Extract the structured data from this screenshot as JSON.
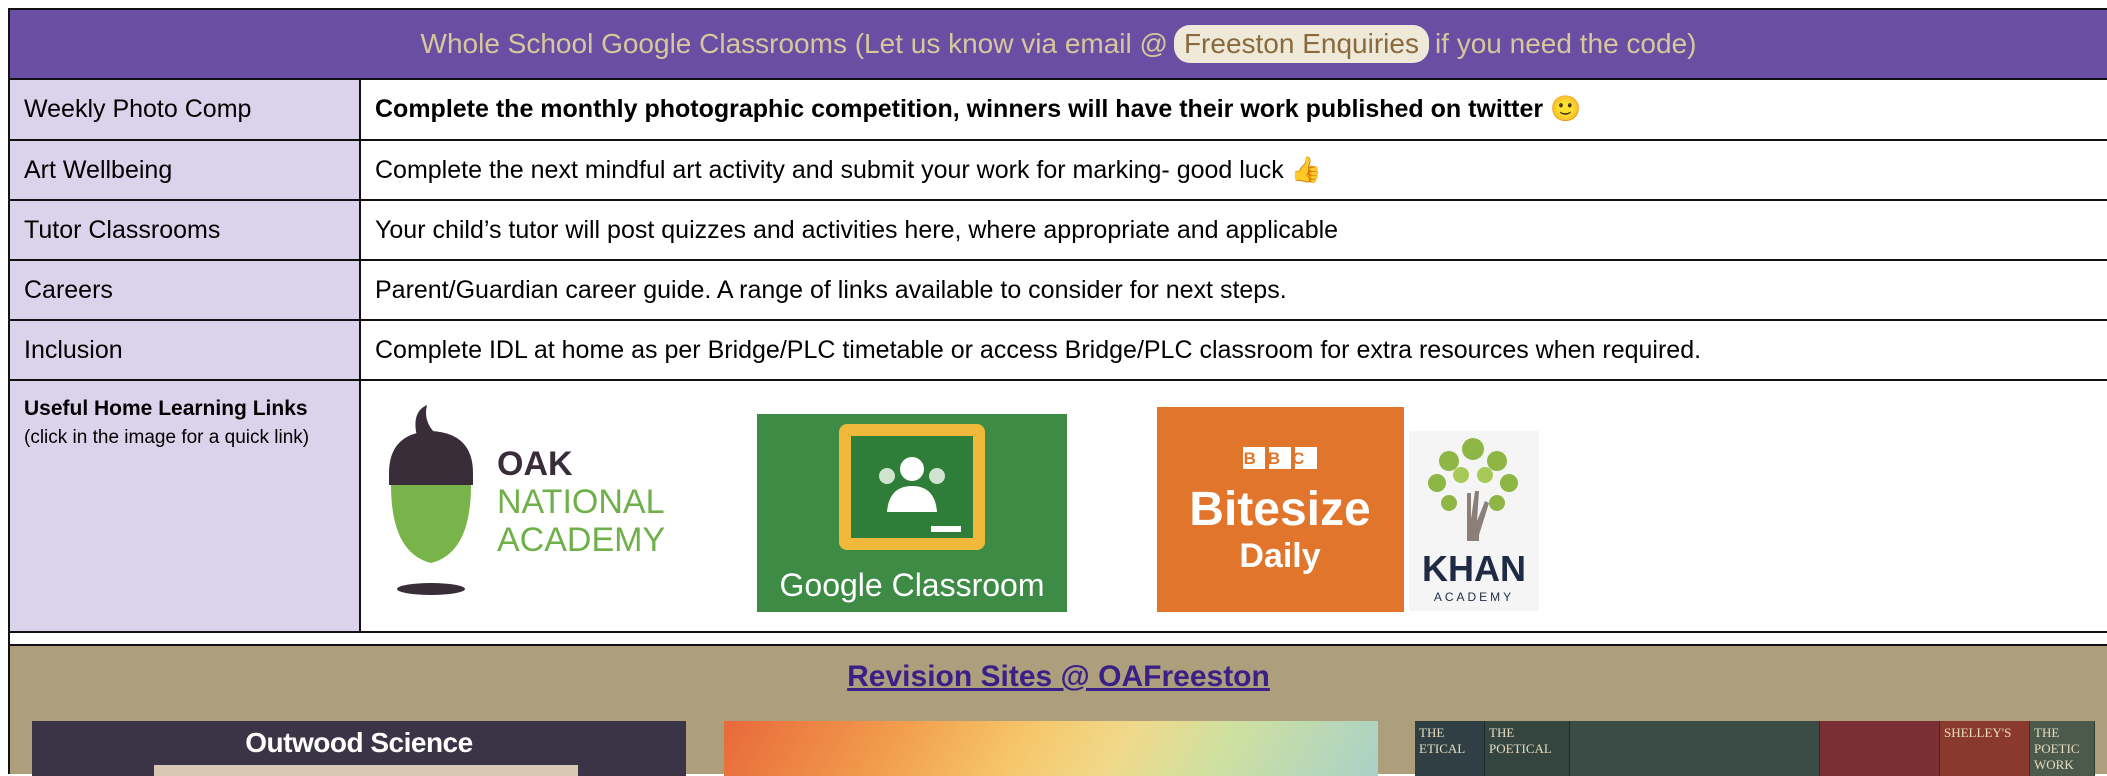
{
  "header": {
    "text_before": "Whole School Google Classrooms (Let us know via email @",
    "link": "Freeston Enquiries",
    "text_after": "if you need the code)"
  },
  "rows": [
    {
      "label": "Weekly Photo Comp",
      "desc": "Complete the monthly photographic competition, winners will have their work published on twitter 🙂",
      "bold": true
    },
    {
      "label": "Art Wellbeing",
      "desc": "Complete the next mindful art activity and submit your work for marking- good luck 👍",
      "bold": false
    },
    {
      "label": "Tutor Classrooms",
      "desc": "Your child’s tutor will post quizzes and activities here, where appropriate and applicable",
      "bold": false
    },
    {
      "label": "Careers",
      "desc": "Parent/Guardian career guide. A range of links available to consider for next steps.",
      "bold": false
    },
    {
      "label": "Inclusion",
      "desc": "Complete IDL at home as per Bridge/PLC timetable or access Bridge/PLC classroom for extra resources when required.",
      "bold": false
    }
  ],
  "links": {
    "title": "Useful Home Learning Links",
    "subtitle": "(click in the image for a quick link)",
    "oak": {
      "line1": "OAK",
      "line2": "NATIONAL",
      "line3": "ACADEMY"
    },
    "google": {
      "text": "Google Classroom"
    },
    "bbc": {
      "brand": "BBC",
      "line1": "Bitesize",
      "line2": "Daily"
    },
    "khan": {
      "line1": "KHAN",
      "line2": "ACADEMY"
    }
  },
  "revision": {
    "title": "Revision Sites @ OAFreeston",
    "thumb1_caption": "Outwood Science",
    "book_spines": [
      "THE ETICAL",
      "THE POETICAL",
      "SHELLEY'S",
      "THE POETIC WORK"
    ]
  },
  "colors": {
    "header_bg": "#6a4ea3",
    "header_text": "#d8c79a",
    "label_bg": "#dbd3ec",
    "revision_bg": "#ad9e7c",
    "revision_title": "#3b1f88"
  }
}
